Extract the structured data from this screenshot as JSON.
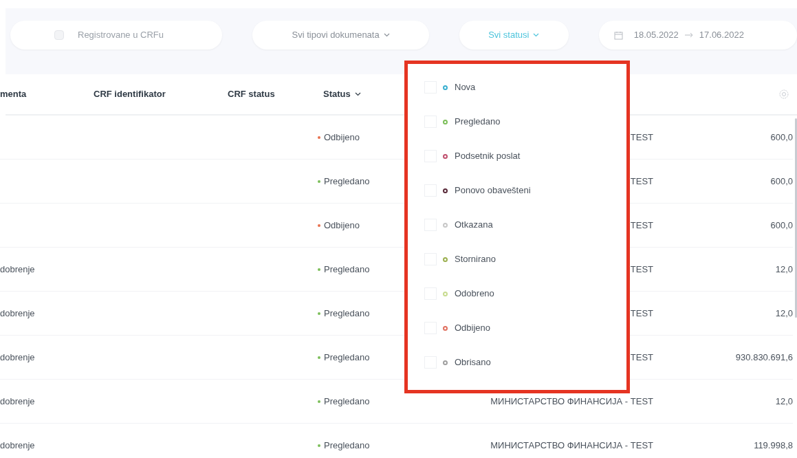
{
  "filters": [
    {
      "kind": "checkbox",
      "label": "Registrovane u CRFu",
      "checked": false
    },
    {
      "kind": "select",
      "label": "Svi tipovi dokumenata",
      "open": false
    },
    {
      "kind": "select",
      "label": "Svi statusi",
      "open": true
    },
    {
      "kind": "daterange",
      "from": "18.05.2022",
      "to": "17.06.2022"
    }
  ],
  "table": {
    "columns": [
      "menta",
      "CRF identifikator",
      "CRF status",
      "Status"
    ],
    "rows": [
      {
        "column_1": "",
        "status": "Odbijeno",
        "color": "#e8714f",
        "organ": "TEST",
        "amount": "600,0"
      },
      {
        "column_1": "",
        "status": "Pregledano",
        "color": "#7cbf5a",
        "organ": "TEST",
        "amount": "600,0"
      },
      {
        "column_1": "",
        "status": "Odbijeno",
        "color": "#e8714f",
        "organ": "TEST",
        "amount": "600,0"
      },
      {
        "column_1": "dobrenje",
        "status": "Pregledano",
        "color": "#7cbf5a",
        "organ": "TEST",
        "amount": "12,0"
      },
      {
        "column_1": "dobrenje",
        "status": "Pregledano",
        "color": "#7cbf5a",
        "organ": "TEST",
        "amount": "12,0"
      },
      {
        "column_1": "dobrenje",
        "status": "Pregledano",
        "color": "#7cbf5a",
        "organ": "TEST",
        "amount": "930.830.691,6"
      },
      {
        "column_1": "dobrenje",
        "status": "Pregledano",
        "color": "#7cbf5a",
        "organ": "МИНИСТАРСТВО ФИНАНСИЈА - TEST",
        "amount": "12,0"
      },
      {
        "column_1": "dobrenje",
        "status": "Pregledano",
        "color": "#7cbf5a",
        "organ": "МИНИСТАРСТВО ФИНАНСИЈА - TEST",
        "amount": "119.998,8"
      }
    ]
  },
  "status_dropdown": {
    "options": [
      {
        "label": "Nova",
        "checked": false,
        "color": "#3bb0d0"
      },
      {
        "label": "Pregledano",
        "checked": false,
        "color": "#7cbf5a"
      },
      {
        "label": "Podsetnik poslat",
        "checked": false,
        "color": "#c0506e"
      },
      {
        "label": "Ponovo obavešteni",
        "checked": false,
        "color": "#5a2a3a"
      },
      {
        "label": "Otkazana",
        "checked": false,
        "color": "#c8c8c8"
      },
      {
        "label": "Stornirano",
        "checked": false,
        "color": "#9cb050"
      },
      {
        "label": "Odobreno",
        "checked": false,
        "color": "#c8dc90"
      },
      {
        "label": "Odbijeno",
        "checked": false,
        "color": "#e07060"
      },
      {
        "label": "Obrisano",
        "checked": false,
        "color": "#a0a0a0"
      }
    ]
  }
}
